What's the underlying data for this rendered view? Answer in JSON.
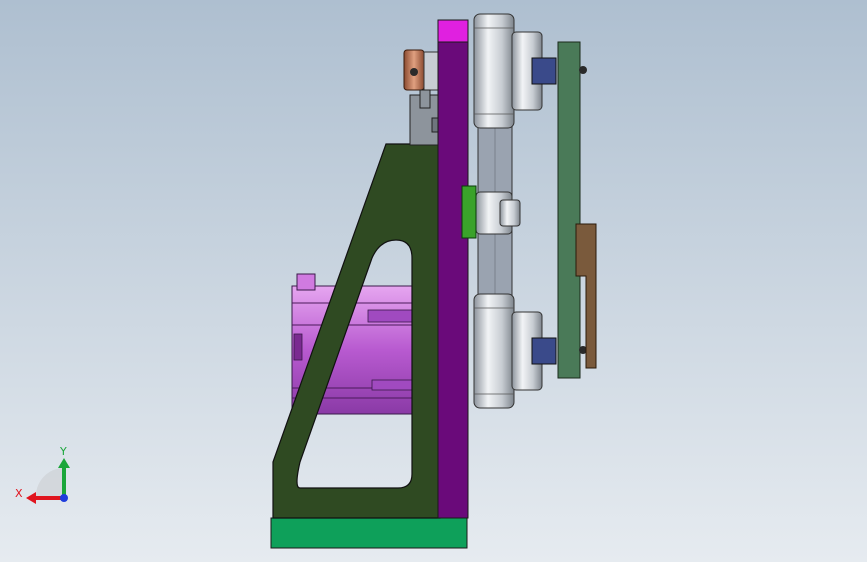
{
  "view": {
    "type": "cad-model-viewport",
    "background_top": "#aebfd0",
    "background_bottom": "#e6ebf0"
  },
  "triad": {
    "x_label": "X",
    "y_label": "Y",
    "x_color": "#e0141e",
    "y_color": "#1aa63a",
    "z_color": "#1e3cdc"
  },
  "colors": {
    "bracket": "#2f4a22",
    "base": "#0ea05a",
    "plate": "#6a0a7a",
    "plate_top": "#e020e0",
    "motor": "#c26ad6",
    "belt": "#9aa3b0",
    "pulley": "#d8dde3",
    "link_green": "#4a7a58",
    "link_brown": "#7a5a3c",
    "nut": "#3a4a8a",
    "bolt": "#3aa22a",
    "collar": "#b86a4a"
  }
}
